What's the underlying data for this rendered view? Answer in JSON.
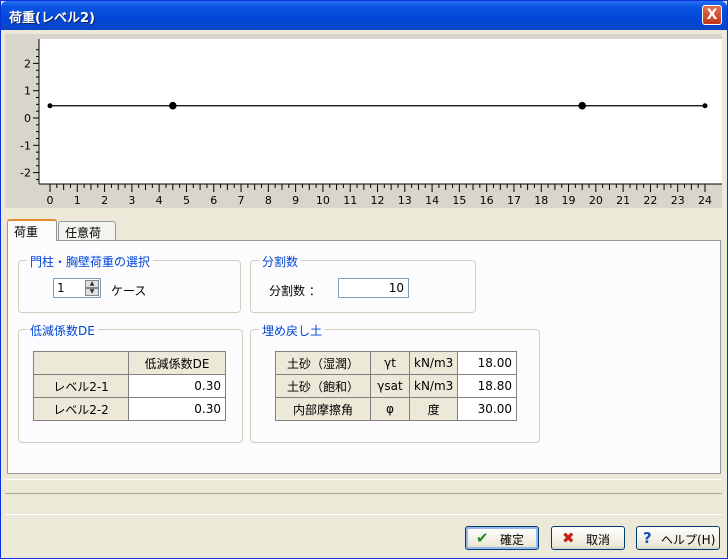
{
  "window": {
    "title": "荷重(レベル2)",
    "close_label": "X"
  },
  "chart_data": {
    "type": "line",
    "x_ticks": [
      "0",
      "1",
      "2",
      "3",
      "4",
      "5",
      "6",
      "7",
      "8",
      "9",
      "10",
      "11",
      "12",
      "13",
      "14",
      "15",
      "16",
      "17",
      "18",
      "19",
      "20",
      "21",
      "22",
      "23",
      "24"
    ],
    "y_ticks": [
      "2",
      "1",
      "0",
      "-1",
      "-2"
    ],
    "xlim": [
      0,
      24
    ],
    "ylim": [
      -2,
      2
    ],
    "series": [
      {
        "x": [
          0,
          4.5,
          19.5,
          24
        ],
        "y": [
          0.45,
          0.45,
          0.45,
          0.45
        ]
      }
    ],
    "markers": [
      {
        "x": 4.5,
        "y": 0.45
      },
      {
        "x": 19.5,
        "y": 0.45
      }
    ],
    "colors": {
      "line": "#000000",
      "plot_bg": "#ffffff",
      "axis_bg": "#d9d5cc"
    }
  },
  "tabs": [
    {
      "label": "荷重"
    },
    {
      "label": "任意荷重"
    }
  ],
  "group_pillar": {
    "title": "門柱・胸壁荷重の選択",
    "spin_value": "1",
    "unit": "ケース"
  },
  "group_divisions": {
    "title": "分割数",
    "label": "分割数 ：",
    "value": "10"
  },
  "group_reduction": {
    "title": "低減係数DE",
    "header": [
      "",
      "低減係数DE"
    ],
    "rows": [
      {
        "label": "レベル2-1",
        "value": "0.30"
      },
      {
        "label": "レベル2-2",
        "value": "0.30"
      }
    ]
  },
  "group_backfill": {
    "title": "埋め戻し土",
    "rows": [
      {
        "name": "土砂（湿潤）",
        "symbol": "γt",
        "unit": "kN/m3",
        "value": "18.00"
      },
      {
        "name": "土砂（飽和）",
        "symbol": "γsat",
        "unit": "kN/m3",
        "value": "18.80"
      },
      {
        "name": "内部摩擦角",
        "symbol": "φ",
        "unit": "度",
        "value": "30.00"
      }
    ]
  },
  "buttons": {
    "ok": {
      "label": "確定",
      "icon": "check-icon"
    },
    "cancel": {
      "label": "取消",
      "icon": "x-icon"
    },
    "help": {
      "label": "ヘルプ(H)",
      "icon": "question-icon"
    }
  }
}
